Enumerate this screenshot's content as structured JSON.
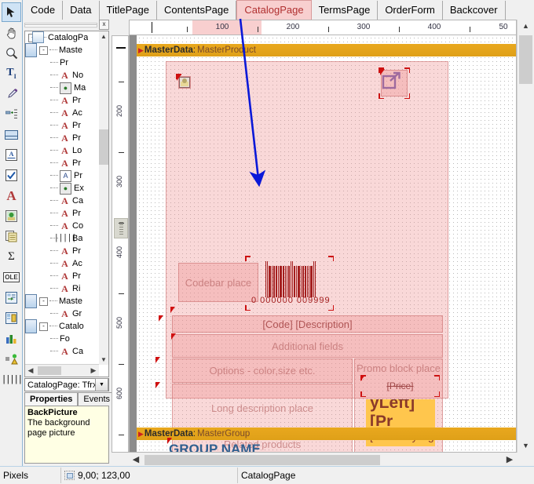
{
  "tabs": [
    {
      "label": "Code",
      "active": false
    },
    {
      "label": "Data",
      "active": false
    },
    {
      "label": "TitlePage",
      "active": false
    },
    {
      "label": "ContentsPage",
      "active": false
    },
    {
      "label": "CatalogPage",
      "active": true
    },
    {
      "label": "TermsPage",
      "active": false
    },
    {
      "label": "OrderForm",
      "active": false
    },
    {
      "label": "Backcover",
      "active": false
    }
  ],
  "toolbar": {
    "items": [
      {
        "name": "select-pointer-tool",
        "glyph": "▲",
        "selected": true
      },
      {
        "name": "hand-pan-tool",
        "glyph": "✋",
        "selected": false
      },
      {
        "name": "zoom-magnifier-tool",
        "glyph": "🔍",
        "selected": false
      },
      {
        "name": "text-tool",
        "glyph": "T",
        "selected": false
      },
      {
        "name": "format-painter-tool",
        "glyph": "🖌",
        "selected": false
      },
      {
        "name": "insert-band-tool",
        "glyph": "⇥",
        "selected": false
      },
      {
        "name": "band-object-tool",
        "glyph": "▭",
        "selected": false
      },
      {
        "name": "rich-text-tool",
        "glyph": "A",
        "selected": false
      },
      {
        "name": "checkbox-tool",
        "glyph": "✔",
        "selected": false
      },
      {
        "name": "text-object-tool",
        "glyph": "A",
        "selected": false
      },
      {
        "name": "picture-object-tool",
        "glyph": "🖼",
        "selected": false
      },
      {
        "name": "subreport-tool",
        "glyph": "❐",
        "selected": false
      },
      {
        "name": "sum-aggregate-tool",
        "glyph": "Σ",
        "selected": false
      },
      {
        "name": "ole-object-tool",
        "glyph": "OLE",
        "selected": false
      },
      {
        "name": "table-object-tool",
        "glyph": "☷",
        "selected": false
      },
      {
        "name": "matrix-object-tool",
        "glyph": "▦",
        "selected": false
      },
      {
        "name": "chart-object-tool",
        "glyph": "📊",
        "selected": false
      },
      {
        "name": "gauge-object-tool",
        "glyph": "⚠",
        "selected": false
      },
      {
        "name": "barcode-object-tool",
        "glyph": "▐█▕",
        "selected": false
      }
    ]
  },
  "dock": {
    "tree": [
      {
        "indent": 0,
        "expander": "-",
        "icon": "page",
        "label": "CatalogPa"
      },
      {
        "indent": 1,
        "expander": "-",
        "icon": "band",
        "label": "Maste"
      },
      {
        "indent": 2,
        "expander": "",
        "icon": "page",
        "label": "Pr"
      },
      {
        "indent": 2,
        "expander": "",
        "icon": "txt",
        "label": "No"
      },
      {
        "indent": 2,
        "expander": "",
        "icon": "pic",
        "label": "Ma"
      },
      {
        "indent": 2,
        "expander": "",
        "icon": "txt",
        "label": "Pr"
      },
      {
        "indent": 2,
        "expander": "",
        "icon": "txt",
        "label": "Ac"
      },
      {
        "indent": 2,
        "expander": "",
        "icon": "txt",
        "label": "Pr"
      },
      {
        "indent": 2,
        "expander": "",
        "icon": "txt",
        "label": "Pr"
      },
      {
        "indent": 2,
        "expander": "",
        "icon": "txt",
        "label": "Lo"
      },
      {
        "indent": 2,
        "expander": "",
        "icon": "txt",
        "label": "Pr"
      },
      {
        "indent": 2,
        "expander": "",
        "icon": "rich",
        "label": "Pr"
      },
      {
        "indent": 2,
        "expander": "",
        "icon": "pic",
        "label": "Ex"
      },
      {
        "indent": 2,
        "expander": "",
        "icon": "txt",
        "label": "Ca"
      },
      {
        "indent": 2,
        "expander": "",
        "icon": "txt",
        "label": "Pr"
      },
      {
        "indent": 2,
        "expander": "",
        "icon": "txt",
        "label": "Co"
      },
      {
        "indent": 2,
        "expander": "",
        "icon": "bar",
        "label": "Ba"
      },
      {
        "indent": 2,
        "expander": "",
        "icon": "txt",
        "label": "Pr"
      },
      {
        "indent": 2,
        "expander": "",
        "icon": "txt",
        "label": "Ac"
      },
      {
        "indent": 2,
        "expander": "",
        "icon": "txt",
        "label": "Pr"
      },
      {
        "indent": 2,
        "expander": "",
        "icon": "txt",
        "label": "Ri"
      },
      {
        "indent": 1,
        "expander": "-",
        "icon": "band",
        "label": "Maste"
      },
      {
        "indent": 2,
        "expander": "",
        "icon": "txt",
        "label": "Gr"
      },
      {
        "indent": 1,
        "expander": "-",
        "icon": "band",
        "label": "Catalo"
      },
      {
        "indent": 2,
        "expander": "",
        "icon": "page",
        "label": "Fo"
      },
      {
        "indent": 2,
        "expander": "",
        "icon": "txt",
        "label": "Ca"
      }
    ],
    "object_combo": "CatalogPage: Tfrx",
    "prop_tabs": [
      {
        "label": "Properties",
        "active": true
      },
      {
        "label": "Events",
        "active": false
      }
    ],
    "hint_title": "BackPicture",
    "hint_desc": "The background page picture"
  },
  "ruler": {
    "h_labels": [
      "100",
      "200",
      "300",
      "400",
      "50"
    ],
    "v_labels": [
      "200",
      "300",
      "400",
      "500",
      "600"
    ],
    "selection_label": "100"
  },
  "canvas": {
    "bands": [
      {
        "name": "MasterData",
        "data": "MasterProduct"
      },
      {
        "name": "MasterData",
        "data": "MasterGroup"
      }
    ],
    "objects": {
      "codebar_place": "Codebar place",
      "barcode_number": "0 000000 009999",
      "code_description": "[Code] [Description]",
      "additional_fields": "Additional fields",
      "options": "Options - color,size etc.",
      "long_description": "Long description place",
      "related_products": "Related products",
      "promo_block": "Promo block place",
      "old_price": "[Price]",
      "price_left": "yLeft][Pr",
      "currency_right": "[CurrencyRig",
      "group_name": "GROUP NAME"
    },
    "icons": {
      "picture_placeholder": "picture-icon",
      "export_link": "external-link-icon"
    }
  },
  "status": {
    "units": "Pixels",
    "coords": "9,00; 123,00",
    "object": "CatalogPage"
  }
}
